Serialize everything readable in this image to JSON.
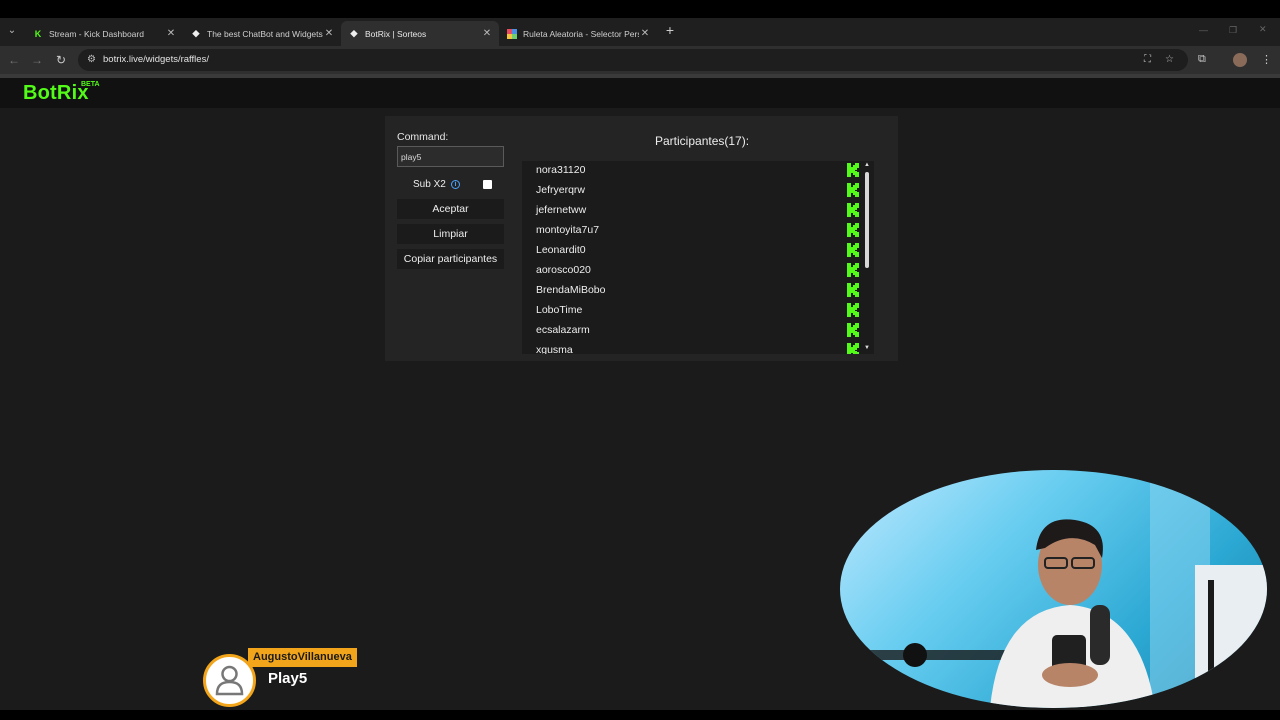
{
  "browser": {
    "tabs": [
      {
        "label": "Stream - Kick Dashboard",
        "favicon": "kick-icon",
        "active": false
      },
      {
        "label": "The best ChatBot and Widgets",
        "favicon": "diamond-icon",
        "active": false
      },
      {
        "label": "BotRix | Sorteos",
        "favicon": "diamond-icon",
        "active": true
      },
      {
        "label": "Ruleta Aleatoria - Selector Perso",
        "favicon": "wheel-icon",
        "active": false
      }
    ],
    "url": "botrix.live/widgets/raffles/"
  },
  "app": {
    "logo": "BotRix",
    "logo_badge": "BETA",
    "accent_color": "#53fc18"
  },
  "raffle": {
    "command_label": "Command:",
    "command_value": "play5",
    "sub_label": "Sub X2",
    "sub_x2_checked": false,
    "accept_label": "Aceptar",
    "clear_label": "Limpiar",
    "copy_label": "Copiar participantes",
    "participants_title": "Participantes(17):",
    "participants": [
      "nora31120",
      "Jefryerqrw",
      "jefernetww",
      "montoyita7u7",
      "Leonardit0",
      "aorosco020",
      "BrendaMiBobo",
      "LoboTime",
      "ecsalazarm",
      "xgusma"
    ]
  },
  "overlay": {
    "username": "AugustoVillanueva",
    "message": "Play5",
    "badge_color": "#f2a51a"
  }
}
